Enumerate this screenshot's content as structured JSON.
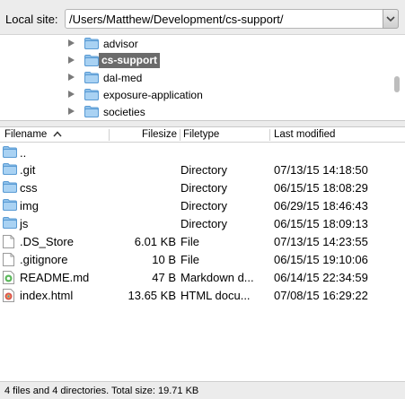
{
  "local_site": {
    "label": "Local site:",
    "path": "/Users/Matthew/Development/cs-support/"
  },
  "tree": {
    "items": [
      {
        "label": "advisor",
        "selected": false
      },
      {
        "label": "cs-support",
        "selected": true
      },
      {
        "label": "dal-med",
        "selected": false
      },
      {
        "label": "exposure-application",
        "selected": false
      },
      {
        "label": "societies",
        "selected": false
      }
    ]
  },
  "columns": {
    "filename": "Filename",
    "filesize": "Filesize",
    "filetype": "Filetype",
    "modified": "Last modified"
  },
  "files": [
    {
      "name": "..",
      "size": "",
      "type": "",
      "modified": "",
      "icon": "folder-icon"
    },
    {
      "name": ".git",
      "size": "",
      "type": "Directory",
      "modified": "07/13/15 14:18:50",
      "icon": "folder-icon"
    },
    {
      "name": "css",
      "size": "",
      "type": "Directory",
      "modified": "06/15/15 18:08:29",
      "icon": "folder-icon"
    },
    {
      "name": "img",
      "size": "",
      "type": "Directory",
      "modified": "06/29/15 18:46:43",
      "icon": "folder-icon"
    },
    {
      "name": "js",
      "size": "",
      "type": "Directory",
      "modified": "06/15/15 18:09:13",
      "icon": "folder-icon"
    },
    {
      "name": ".DS_Store",
      "size": "6.01 KB",
      "type": "File",
      "modified": "07/13/15 14:23:55",
      "icon": "file-icon"
    },
    {
      "name": ".gitignore",
      "size": "10 B",
      "type": "File",
      "modified": "06/15/15 19:10:06",
      "icon": "file-icon"
    },
    {
      "name": "README.md",
      "size": "47 B",
      "type": "Markdown d...",
      "modified": "06/14/15 22:34:59",
      "icon": "markdown-file-icon"
    },
    {
      "name": "index.html",
      "size": "13.65 KB",
      "type": "HTML docu...",
      "modified": "07/08/15 16:29:22",
      "icon": "html-file-icon"
    }
  ],
  "status": {
    "text": "4 files and 4 directories. Total size: 19.71 KB"
  }
}
